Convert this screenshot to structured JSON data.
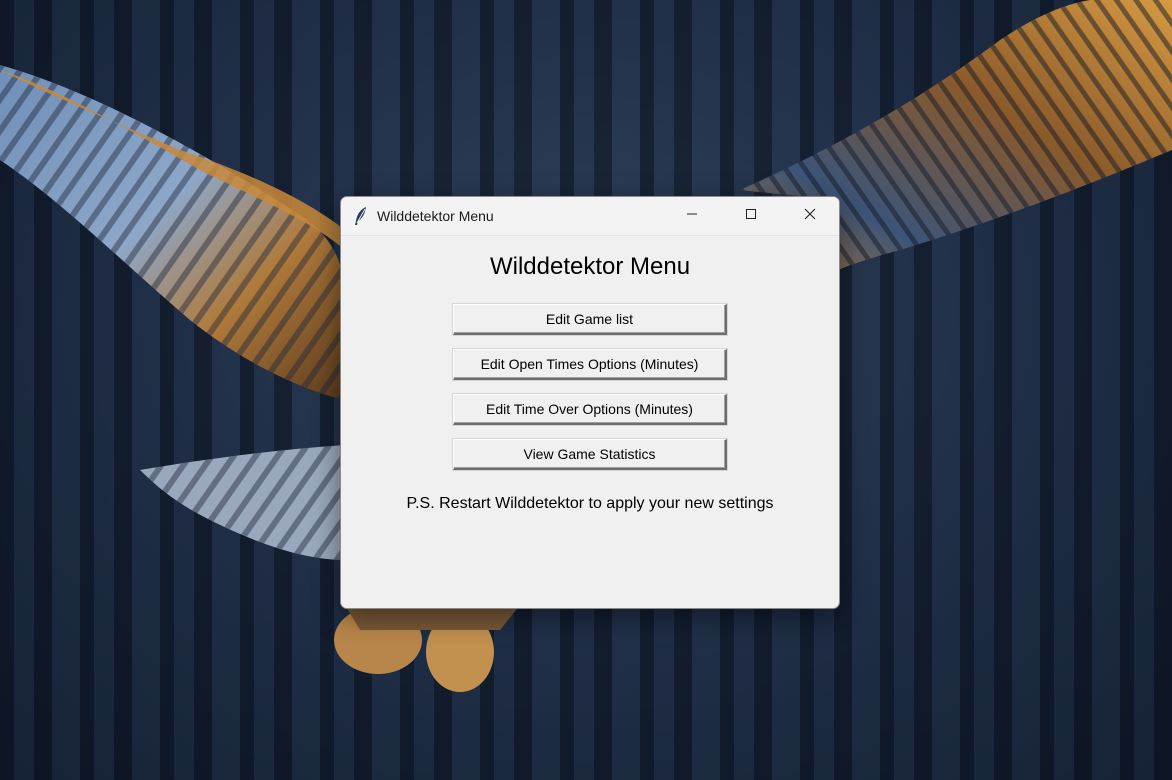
{
  "window": {
    "title": "Wilddetektor Menu",
    "app_icon": "feather-icon",
    "controls": {
      "minimize": "minimize-icon",
      "maximize": "maximize-icon",
      "close": "close-icon"
    }
  },
  "content": {
    "heading": "Wilddetektor Menu",
    "buttons": [
      {
        "label": "Edit Game list"
      },
      {
        "label": "Edit Open Times Options (Minutes)"
      },
      {
        "label": "Edit Time Over Options (Minutes)"
      },
      {
        "label": "View Game Statistics"
      }
    ],
    "note": "P.S. Restart Wilddetektor to apply your new settings"
  },
  "colors": {
    "window_bg": "#f0f0f0",
    "wallpaper_dark": "#1a2840",
    "owl_wing_orange": "#c8892e"
  }
}
